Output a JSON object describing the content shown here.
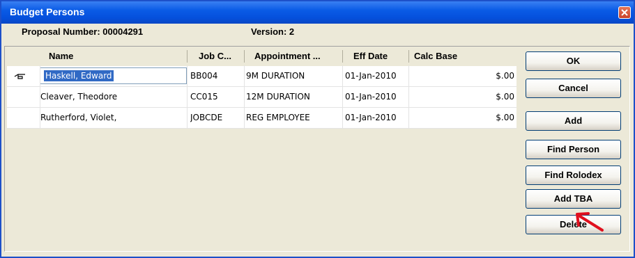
{
  "window": {
    "title": "Budget Persons"
  },
  "info": {
    "proposal": "Proposal Number: 00004291",
    "version": "Version: 2"
  },
  "table": {
    "headers": [
      "Name",
      "Job C...",
      "Appointment ...",
      "Eff Date",
      "Calc Base"
    ],
    "rows": [
      {
        "name": "Haskell, Edward",
        "job_code": "BB004",
        "appointment": "9M DURATION",
        "eff_date": "01-Jan-2010",
        "calc_base": "$.00"
      },
      {
        "name": "Cleaver, Theodore",
        "job_code": "CC015",
        "appointment": "12M DURATION",
        "eff_date": "01-Jan-2010",
        "calc_base": "$.00"
      },
      {
        "name": "Rutherford, Violet,",
        "job_code": "JOBCDE",
        "appointment": "REG EMPLOYEE",
        "eff_date": "01-Jan-2010",
        "calc_base": "$.00"
      }
    ]
  },
  "buttons": {
    "ok": "OK",
    "cancel": "Cancel",
    "add": "Add",
    "find_person": "Find Person",
    "find_rolodex": "Find Rolodex",
    "add_tba": "Add TBA",
    "delete": "Delete"
  },
  "colors": {
    "titlebar": "#0a5be6",
    "selection": "#316ac5",
    "annotation_arrow": "#e0101e"
  },
  "icons": {
    "close": "close-icon",
    "row_pointer": "pointing-hand-icon",
    "annotation": "red-arrow-icon"
  }
}
